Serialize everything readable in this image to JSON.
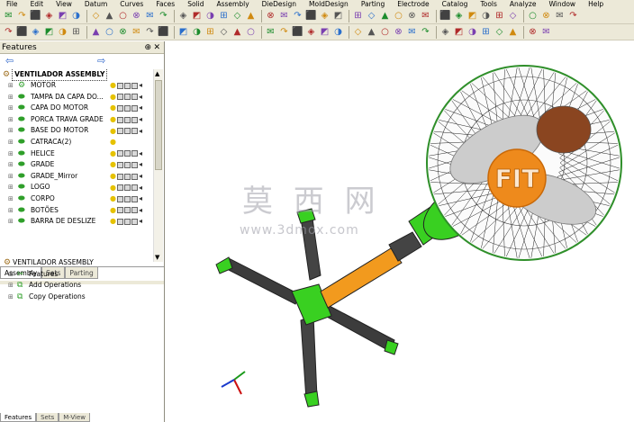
{
  "menu": [
    "File",
    "Edit",
    "View",
    "Datum",
    "Curves",
    "Faces",
    "Solid",
    "Assembly",
    "DieDesign",
    "MoldDesign",
    "Parting",
    "Electrode",
    "Catalog",
    "Tools",
    "Analyze",
    "Window",
    "Help"
  ],
  "features_panel": {
    "title": "Features",
    "root": "VENTILADOR ASSEMBLY",
    "items": [
      {
        "label": "MOTOR"
      },
      {
        "label": "TAMPA DA CAPA DO..."
      },
      {
        "label": "CAPA DO MOTOR"
      },
      {
        "label": "PORCA TRAVA GRADE"
      },
      {
        "label": "BASE DO MOTOR"
      },
      {
        "label": "CATRACA(2)"
      },
      {
        "label": "HELICE"
      },
      {
        "label": "GRADE"
      },
      {
        "label": "GRADE_Mirror"
      },
      {
        "label": "LOGO"
      },
      {
        "label": "CORPO"
      },
      {
        "label": "BOTÕES"
      },
      {
        "label": "BARRA DE DESLIZE"
      }
    ],
    "tabs": [
      "Assembly",
      "Sets",
      "Parting"
    ]
  },
  "operations_panel": {
    "root": "VENTILADOR ASSEMBLY",
    "items": [
      "Features",
      "Add Operations",
      "Copy Operations"
    ],
    "tabs": [
      "Features",
      "Sets",
      "M-View"
    ]
  },
  "viewport": {
    "logo_text": "FIT",
    "watermark_cn": "莫 西 网",
    "watermark_url": "www.3dmox.com"
  },
  "colors": {
    "accent_green": "#39d021",
    "body_orange": "#f29a1e",
    "grill_green": "#2f8f2a",
    "logo_orange": "#ee8a1c"
  }
}
